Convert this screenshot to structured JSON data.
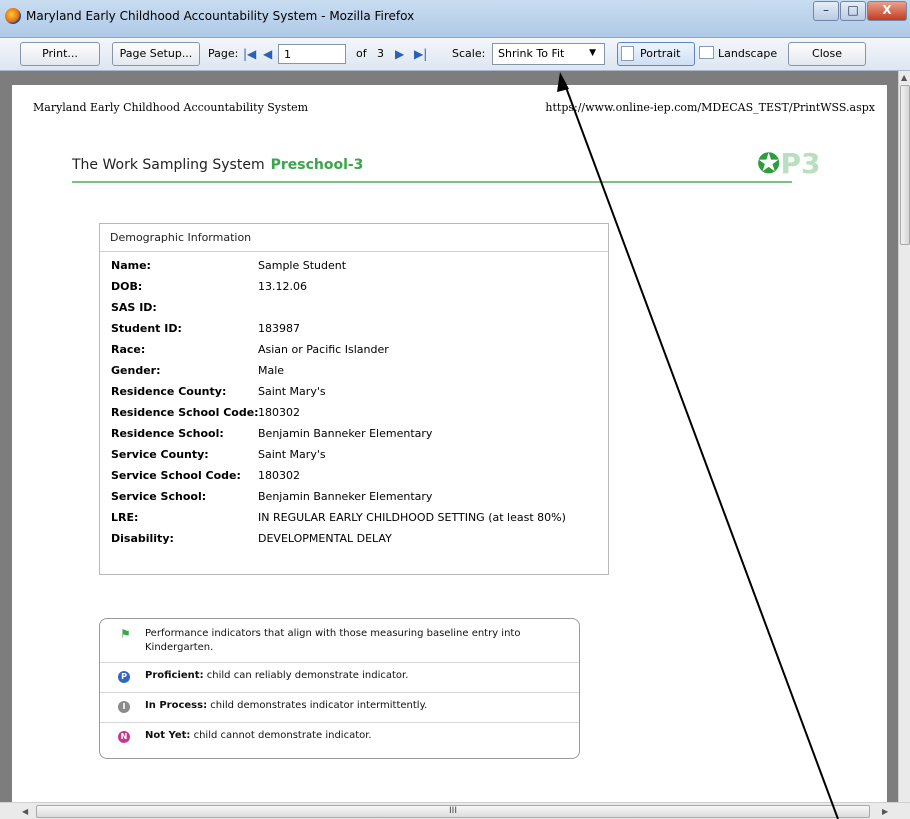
{
  "window": {
    "title": "Maryland Early Childhood Accountability System - Mozilla Firefox",
    "minimize": "–",
    "maximize": "□",
    "close": "X"
  },
  "toolbar": {
    "print_label": "Print...",
    "page_setup_label": "Page Setup...",
    "page_label": "Page:",
    "page_value": "1",
    "of_label": "of",
    "total_pages": "3",
    "scale_label": "Scale:",
    "scale_value": "Shrink To Fit",
    "portrait_label": "Portrait",
    "landscape_label": "Landscape",
    "close_label": "Close"
  },
  "page": {
    "header_left": "Maryland Early Childhood Accountability System",
    "header_right": "https://www.online-iep.com/MDECAS_TEST/PrintWSS.aspx",
    "system_name": "The Work Sampling System",
    "grade": "Preschool-3",
    "logo_text": "P3",
    "demographics_title": "Demographic Information",
    "demographics": [
      {
        "label": "Name:",
        "value": "Sample Student"
      },
      {
        "label": "DOB:",
        "value": "13.12.06"
      },
      {
        "label": "SAS ID:",
        "value": ""
      },
      {
        "label": "Student ID:",
        "value": "183987"
      },
      {
        "label": "Race:",
        "value": "Asian or Pacific Islander"
      },
      {
        "label": "Gender:",
        "value": "Male"
      },
      {
        "label": "Residence County:",
        "value": "Saint Mary's"
      },
      {
        "label": "Residence School Code:",
        "value": "180302"
      },
      {
        "label": "Residence School:",
        "value": "Benjamin Banneker Elementary"
      },
      {
        "label": "Service County:",
        "value": "Saint Mary's"
      },
      {
        "label": "Service School Code:",
        "value": "180302"
      },
      {
        "label": "Service School:",
        "value": "Benjamin Banneker Elementary"
      },
      {
        "label": "LRE:",
        "value": "IN REGULAR EARLY CHILDHOOD SETTING (at least 80%)"
      },
      {
        "label": "Disability:",
        "value": "DEVELOPMENTAL DELAY"
      }
    ],
    "legend": {
      "flag_text": "Performance indicators that align with those measuring baseline entry into Kindergarten.",
      "proficient_label": "Proficient:",
      "proficient_text": "child can reliably demonstrate indicator.",
      "inprocess_label": "In Process:",
      "inprocess_text": "child demonstrates indicator intermittently.",
      "notyet_label": "Not Yet:",
      "notyet_text": "child cannot demonstrate indicator.",
      "p_letter": "P",
      "i_letter": "I",
      "n_letter": "N"
    }
  },
  "scroll": {
    "h_grip": "III"
  },
  "colors": {
    "proficient": "#2f66c9",
    "inprocess": "#8a8a8a",
    "notyet": "#c4398f",
    "grade": "#3aa64a"
  }
}
